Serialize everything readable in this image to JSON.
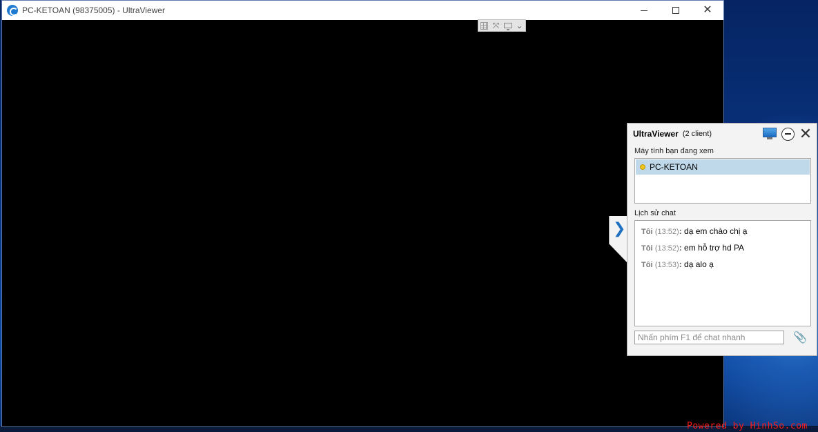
{
  "window": {
    "title": "PC-KETOAN (98375005) - UltraViewer",
    "controls": {
      "minimize": "minimize",
      "maximize": "maximize",
      "close": "close"
    }
  },
  "remote_toolbar": {
    "icons": [
      "grid-icon",
      "fullscreen-icon",
      "monitor-icon",
      "chevron-down-icon"
    ]
  },
  "chat_panel": {
    "title": "UltraViewer",
    "client_count": "(2 client)",
    "computers_label": "Máy tính bạn đang xem",
    "clients": [
      {
        "name": "PC-KETOAN",
        "status_color": "#f0c419"
      }
    ],
    "history_label": "Lịch sử chat",
    "messages": [
      {
        "who": "Tôi",
        "time": "(13:52)",
        "text": "dạ em chào chị ạ"
      },
      {
        "who": "Tôi",
        "time": "(13:52)",
        "text": "em hỗ trợ hd PA"
      },
      {
        "who": "Tôi",
        "time": "(13:53)",
        "text": "dạ alo ạ"
      }
    ],
    "input_placeholder": "Nhấn phím F1 để chat nhanh"
  },
  "watermark": "Powered by HinhSo.com",
  "colors": {
    "accent": "#1e6fc0",
    "selected_row": "#bfd8ea",
    "watermark": "#ff1a1a"
  }
}
